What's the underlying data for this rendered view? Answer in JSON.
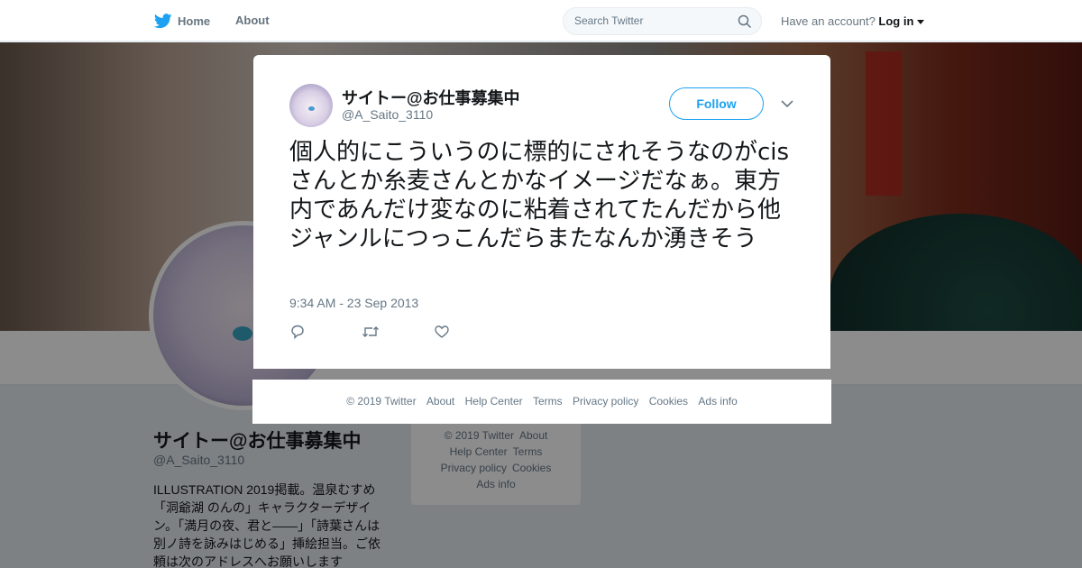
{
  "nav": {
    "home_label": "Home",
    "about_label": "About",
    "search_placeholder": "Search Twitter",
    "have_account": "Have an account?",
    "login_label": "Log in",
    "brand_color": "#1da1f2"
  },
  "profile": {
    "name": "サイトー@お仕事募集中",
    "handle": "@A_Saito_3110",
    "bio": "ILLUSTRATION 2019掲載。温泉むすめ「洞爺湖 のんの」キャラクターデザイン。「満月の夜、君と——」「詩葉さんは別ノ詩を詠みはじめる」挿絵担当。ご依頼は次のアドレスへお願いします"
  },
  "page_footer": {
    "links": [
      "© 2019 Twitter",
      "About",
      "Help Center",
      "Terms",
      "Privacy policy",
      "Cookies",
      "Ads info"
    ]
  },
  "tweet": {
    "author_name": "サイトー@お仕事募集中",
    "author_handle": "@A_Saito_3110",
    "follow_label": "Follow",
    "text": "個人的にこういうのに標的にされそうなのがcisさんとか糸麦さんとかなイメージだなぁ。東方内であんだけ変なのに粘着されてたんだから他ジャンルにつっこんだらまたなんか湧きそう",
    "timestamp": "9:34 AM - 23 Sep 2013",
    "icons": [
      "reply-icon",
      "retweet-icon",
      "like-icon"
    ]
  },
  "modal_footer": {
    "links": [
      "© 2019 Twitter",
      "About",
      "Help Center",
      "Terms",
      "Privacy policy",
      "Cookies",
      "Ads info"
    ]
  }
}
